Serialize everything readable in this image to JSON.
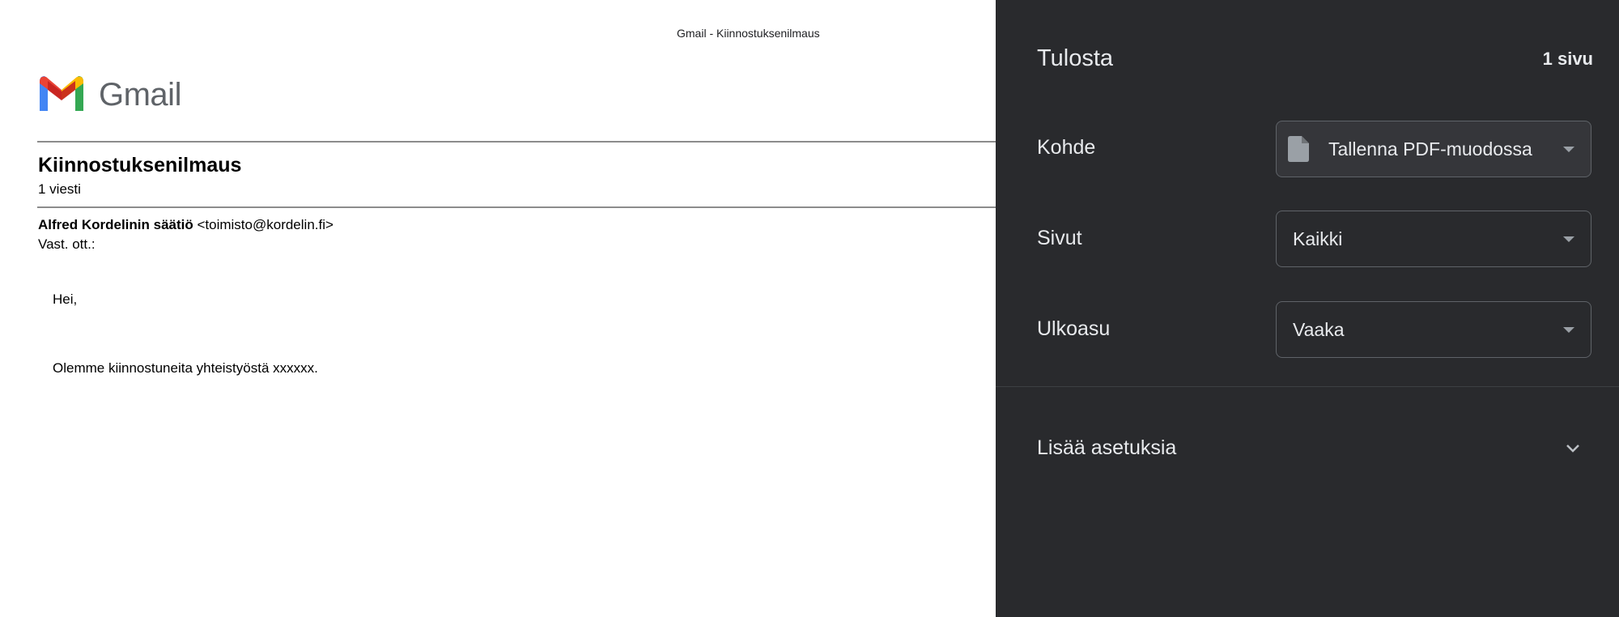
{
  "preview": {
    "header_title": "Gmail - Kiinnostuksenilmaus",
    "brand": "Gmail",
    "subject": "Kiinnostuksenilmaus",
    "message_count": "1 viesti",
    "sender_name": "Alfred Kordelinin säätiö",
    "sender_email": "<toimisto@kordelin.fi>",
    "recipient_label": "Vast. ott.:",
    "greeting": "Hei,",
    "body": "Olemme kiinnostuneita yhteistyöstä xxxxxx."
  },
  "panel": {
    "title": "Tulosta",
    "page_count": "1 sivu",
    "destination_label": "Kohde",
    "destination_value": "Tallenna PDF-muodossa",
    "pages_label": "Sivut",
    "pages_value": "Kaikki",
    "layout_label": "Ulkoasu",
    "layout_value": "Vaaka",
    "more_settings": "Lisää asetuksia"
  },
  "colors": {
    "panel_bg": "#292a2d",
    "panel_text": "#e8eaed",
    "gmail_red": "#ea4335",
    "gmail_blue": "#4285f4",
    "gmail_green": "#34a853",
    "gmail_yellow": "#fbbc04"
  },
  "icons": {
    "logo": "gmail-logo-icon",
    "destination": "file-icon",
    "dropdown": "caret-down-icon",
    "expand": "chevron-down-icon"
  }
}
